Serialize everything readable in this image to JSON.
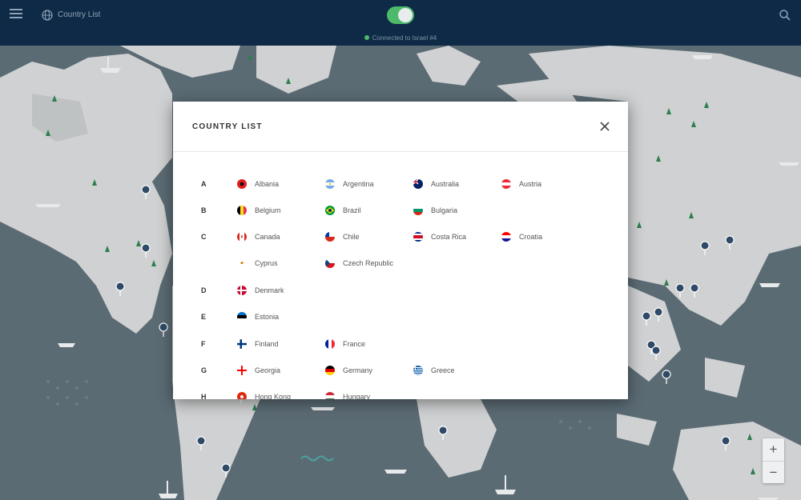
{
  "topbar": {
    "title": "Country List",
    "status": "Connected to Israel #4",
    "toggle_on": true,
    "accent_color": "#4cb96b",
    "background_color": "#0e2a47"
  },
  "modal": {
    "title": "COUNTRY LIST",
    "sections": [
      {
        "letter": "A",
        "countries": [
          "Albania",
          "Argentina",
          "Australia",
          "Austria"
        ]
      },
      {
        "letter": "B",
        "countries": [
          "Belgium",
          "Brazil",
          "Bulgaria"
        ]
      },
      {
        "letter": "C",
        "countries": [
          "Canada",
          "Chile",
          "Costa Rica",
          "Croatia",
          "Cyprus",
          "Czech Republic"
        ]
      },
      {
        "letter": "D",
        "countries": [
          "Denmark"
        ]
      },
      {
        "letter": "E",
        "countries": [
          "Estonia"
        ]
      },
      {
        "letter": "F",
        "countries": [
          "Finland",
          "France"
        ]
      },
      {
        "letter": "G",
        "countries": [
          "Georgia",
          "Germany",
          "Greece"
        ]
      },
      {
        "letter": "H",
        "countries": [
          "Hong Kong",
          "Hungary"
        ]
      }
    ]
  },
  "zoom": {
    "in_label": "+",
    "out_label": "−"
  },
  "icons": [
    "menu-icon",
    "globe-icon",
    "search-icon",
    "close-icon",
    "location-pin-icon",
    "tree-icon",
    "ship-icon"
  ]
}
